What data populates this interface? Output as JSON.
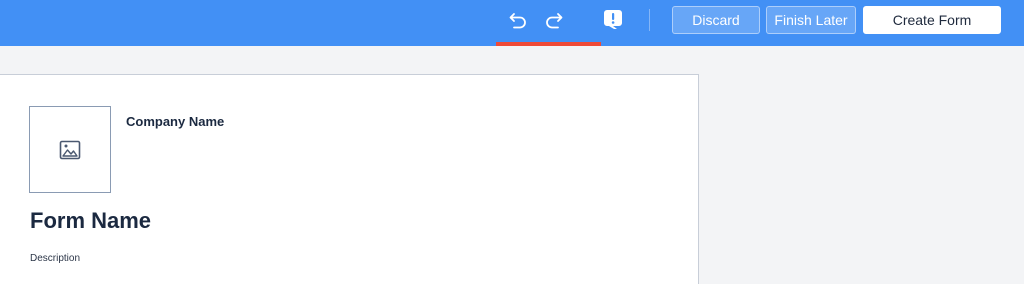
{
  "toolbar": {
    "undo_icon": "undo-icon",
    "redo_icon": "redo-icon",
    "feedback_icon": "feedback-icon",
    "discard_label": "Discard",
    "finish_later_label": "Finish Later",
    "create_form_label": "Create Form",
    "bar_color": "#4290f5",
    "accent_underline_color": "#ee4a37"
  },
  "form": {
    "logo_placeholder_icon": "image-placeholder-icon",
    "company_name": "Company Name",
    "form_name": "Form Name",
    "description_label": "Description"
  }
}
